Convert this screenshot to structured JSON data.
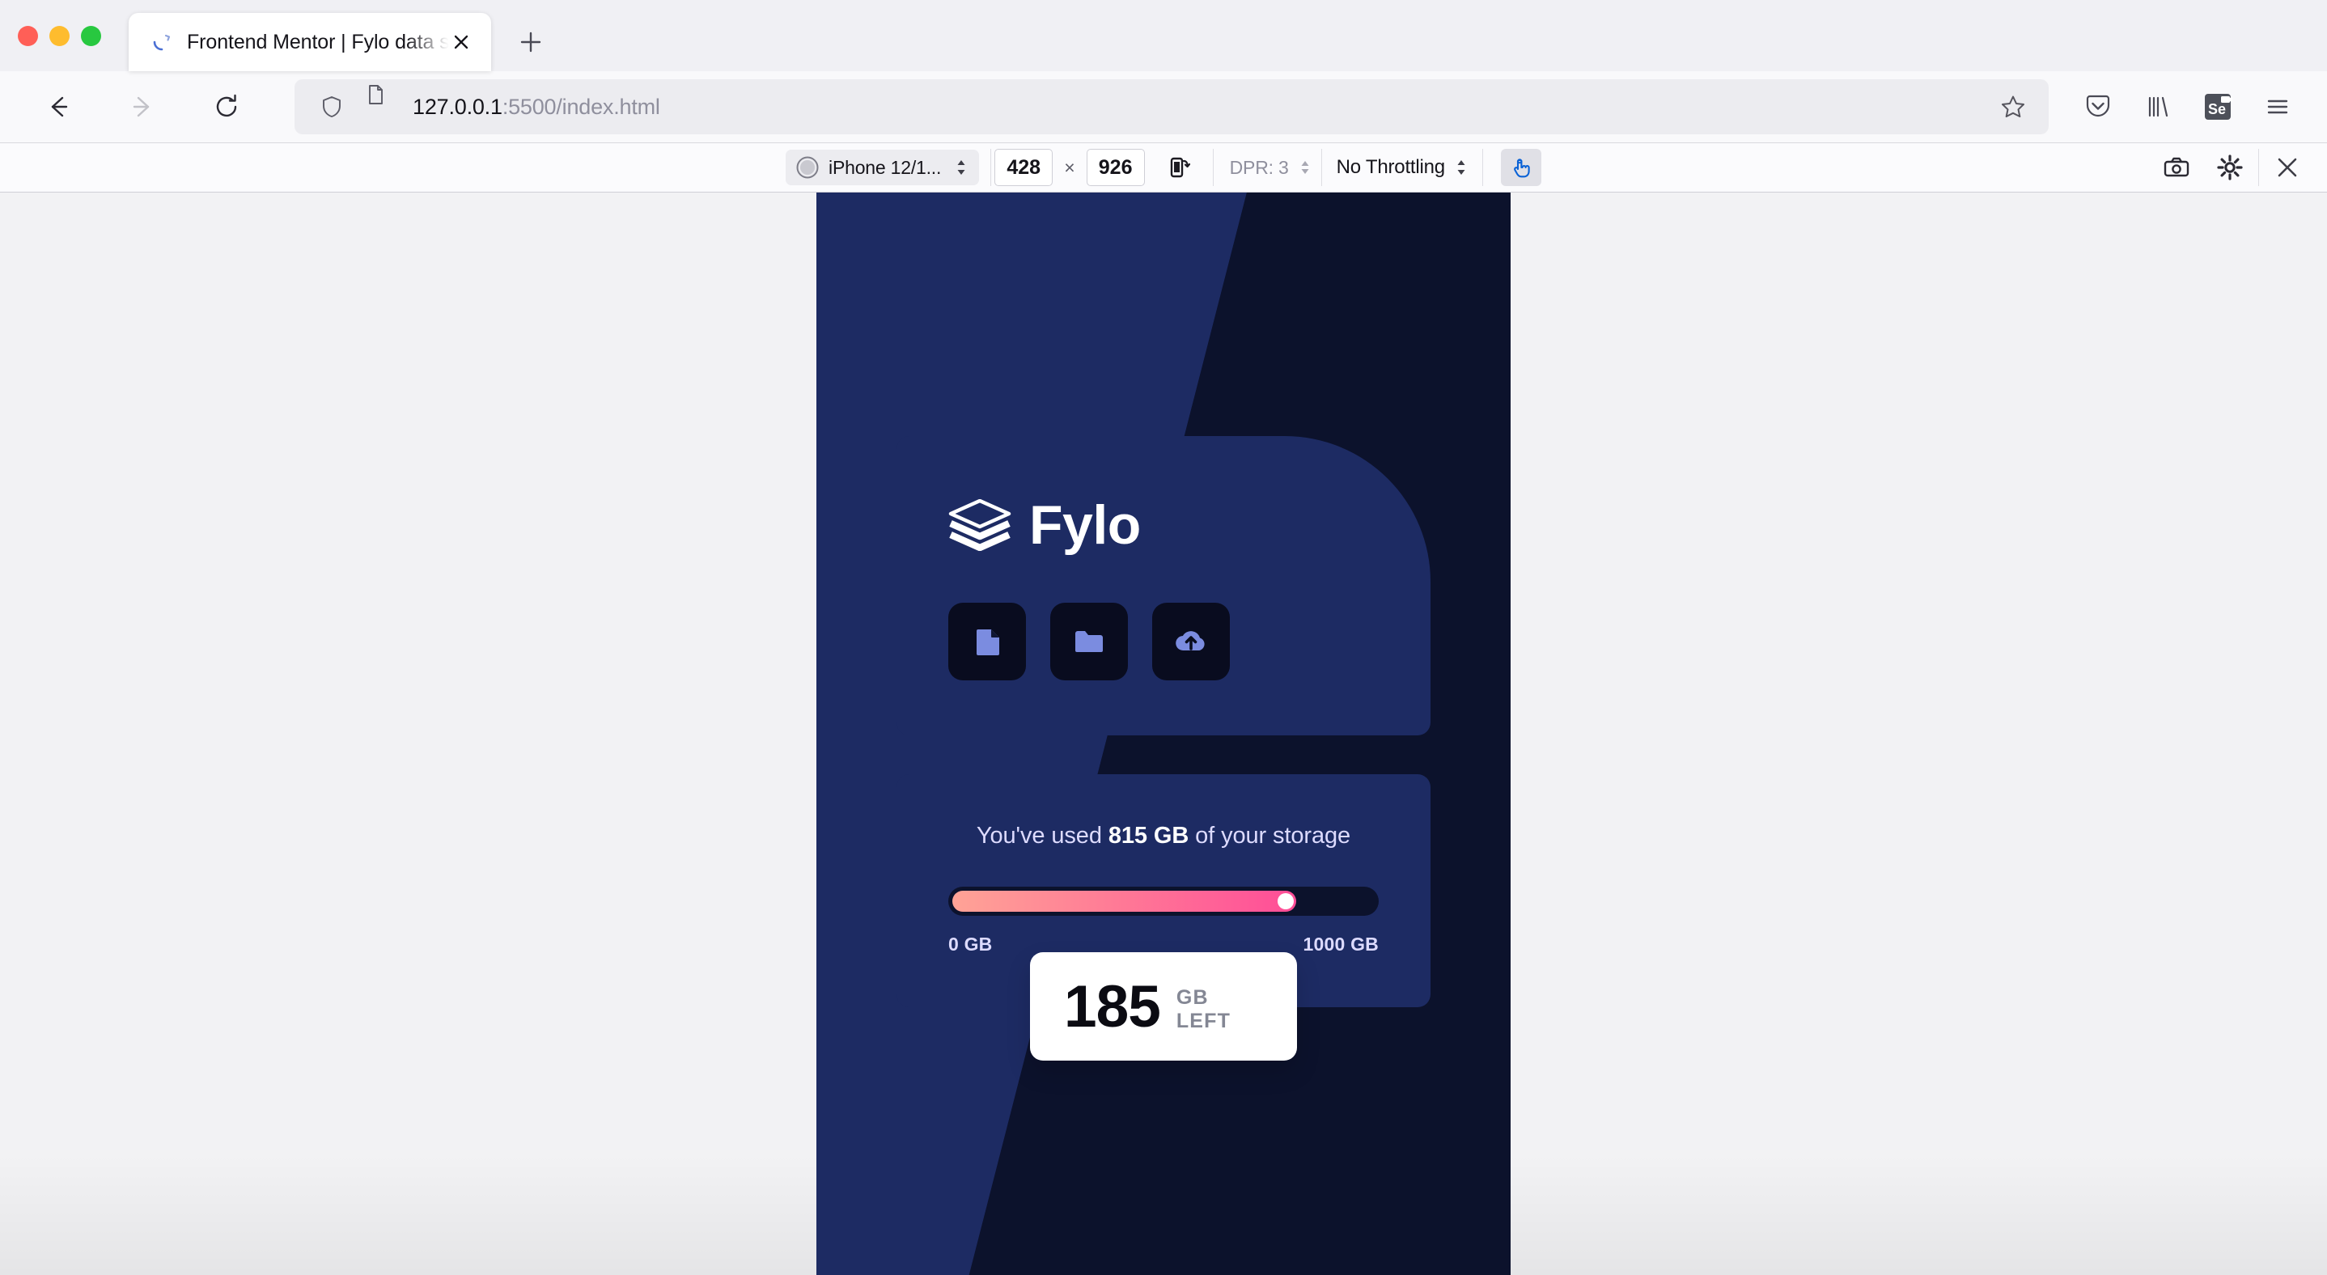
{
  "window": {
    "traffic_lights": [
      "close",
      "minimize",
      "maximize"
    ]
  },
  "tabstrip": {
    "tab_title": "Frontend Mentor | Fylo data storage component",
    "favicon_name": "loading-spinner-icon",
    "close_label": "×",
    "new_tab_label": "+"
  },
  "navbar": {
    "back_label": "Back",
    "forward_label": "Forward",
    "reload_label": "Reload",
    "url_host": "127.0.0.1",
    "url_path": ":5500/index.html",
    "url_full": "127.0.0.1:5500/index.html",
    "shield_name": "tracking-protection-shield-icon",
    "page_icon_name": "page-info-icon",
    "bookmark_name": "bookmark-star-icon",
    "toolbar_icons": [
      {
        "name": "pocket-icon"
      },
      {
        "name": "library-icon"
      },
      {
        "name": "selenium-extension-icon",
        "label": "Se"
      },
      {
        "name": "hamburger-menu-icon"
      }
    ]
  },
  "rdm": {
    "device": "iPhone 12/1...",
    "device_icon": "safari-browser-icon",
    "width": "428",
    "height": "926",
    "separator": "×",
    "rotate_name": "rotate-viewport-icon",
    "dpr_label": "DPR: 3",
    "throttling": "No Throttling",
    "touch_simulation_name": "touch-simulation-icon",
    "touch_simulation_active": true,
    "right_icons": [
      {
        "name": "screenshot-camera-icon"
      },
      {
        "name": "rdm-settings-gear-icon"
      },
      {
        "name": "close-rdm-icon"
      }
    ]
  },
  "page": {
    "brand": {
      "name": "Fylo",
      "logo_name": "fylo-layers-logo-icon"
    },
    "shortcuts": [
      {
        "name": "document-icon",
        "label": "Document"
      },
      {
        "name": "folder-icon",
        "label": "Folder"
      },
      {
        "name": "cloud-upload-icon",
        "label": "Upload"
      }
    ],
    "storage": {
      "used_prefix": "You've used ",
      "used_amount": "815 GB",
      "used_suffix": " of your storage",
      "min_label": "0 GB",
      "max_label": "1000 GB",
      "percent_used": 81.5,
      "remaining_value": "185",
      "remaining_label": "GB LEFT"
    },
    "colors": {
      "bg_dark": "#0C122C",
      "bg_navy": "#1D2B63",
      "card": "#1D2B63",
      "tile": "#090C1F",
      "gradient_start": "#FFA396",
      "gradient_end": "#FF4D97",
      "pale_blue": "#DDDBFF",
      "icon_blue": "#7b8ce0"
    }
  }
}
